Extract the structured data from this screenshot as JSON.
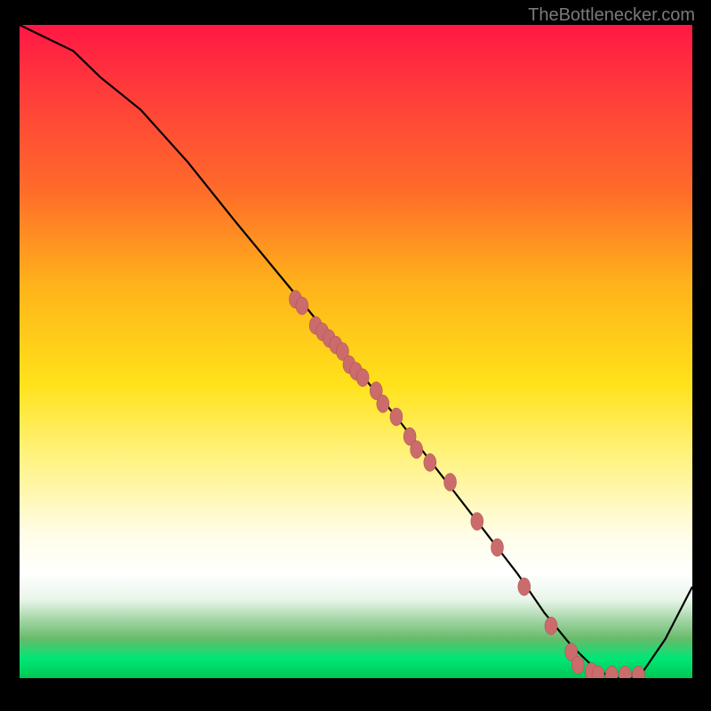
{
  "watermark": "TheBottlenecker.com",
  "chart_data": {
    "type": "line",
    "title": "",
    "xlabel": "",
    "ylabel": "",
    "xlim": [
      0,
      100
    ],
    "ylim": [
      0,
      100
    ],
    "grid": false,
    "series": [
      {
        "name": "bottleneck-curve",
        "x": [
          0,
          4,
          8,
          12,
          18,
          25,
          32,
          40,
          48,
          56,
          62,
          68,
          74,
          78,
          82,
          85,
          88,
          92,
          96,
          100
        ],
        "y": [
          100,
          98,
          96,
          92,
          87,
          79,
          70,
          60,
          50,
          40,
          32,
          24,
          16,
          10,
          5,
          2,
          0,
          0,
          6,
          14
        ]
      }
    ],
    "scatter": {
      "name": "highlighted-points",
      "points": [
        {
          "x": 41,
          "y": 58
        },
        {
          "x": 42,
          "y": 57
        },
        {
          "x": 44,
          "y": 54
        },
        {
          "x": 45,
          "y": 53
        },
        {
          "x": 46,
          "y": 52
        },
        {
          "x": 47,
          "y": 51
        },
        {
          "x": 48,
          "y": 50
        },
        {
          "x": 49,
          "y": 48
        },
        {
          "x": 50,
          "y": 47
        },
        {
          "x": 51,
          "y": 46
        },
        {
          "x": 53,
          "y": 44
        },
        {
          "x": 54,
          "y": 42
        },
        {
          "x": 56,
          "y": 40
        },
        {
          "x": 58,
          "y": 37
        },
        {
          "x": 59,
          "y": 35
        },
        {
          "x": 61,
          "y": 33
        },
        {
          "x": 64,
          "y": 30
        },
        {
          "x": 68,
          "y": 24
        },
        {
          "x": 71,
          "y": 20
        },
        {
          "x": 75,
          "y": 14
        },
        {
          "x": 79,
          "y": 8
        },
        {
          "x": 82,
          "y": 4
        },
        {
          "x": 83,
          "y": 2
        },
        {
          "x": 85,
          "y": 1
        },
        {
          "x": 86,
          "y": 0.5
        },
        {
          "x": 88,
          "y": 0.5
        },
        {
          "x": 90,
          "y": 0.5
        },
        {
          "x": 92,
          "y": 0.5
        }
      ]
    },
    "background": "red-yellow-green-gradient"
  }
}
